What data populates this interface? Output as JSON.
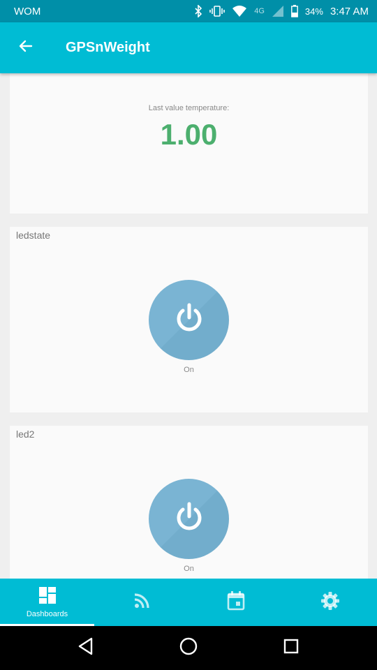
{
  "status_bar": {
    "carrier": "WOM",
    "network": "4G",
    "battery": "34%",
    "time": "3:47 AM"
  },
  "app_bar": {
    "title": "GPSnWeight"
  },
  "widgets": {
    "temperature": {
      "label": "Last value temperature:",
      "value": "1.00",
      "color": "#4caf6e"
    },
    "led1": {
      "title": "ledstate",
      "state": "On"
    },
    "led2": {
      "title": "led2",
      "state": "On"
    }
  },
  "bottom_nav": {
    "items": [
      {
        "label": "Dashboards",
        "icon": "dashboard-icon",
        "active": true
      },
      {
        "label": "",
        "icon": "rss-feed-icon",
        "active": false
      },
      {
        "label": "",
        "icon": "calendar-event-icon",
        "active": false
      },
      {
        "label": "",
        "icon": "settings-gear-icon",
        "active": false
      }
    ]
  },
  "colors": {
    "primary": "#00bcd4",
    "primary_dark": "#008fa8",
    "power_button": "#7ab4d3"
  }
}
